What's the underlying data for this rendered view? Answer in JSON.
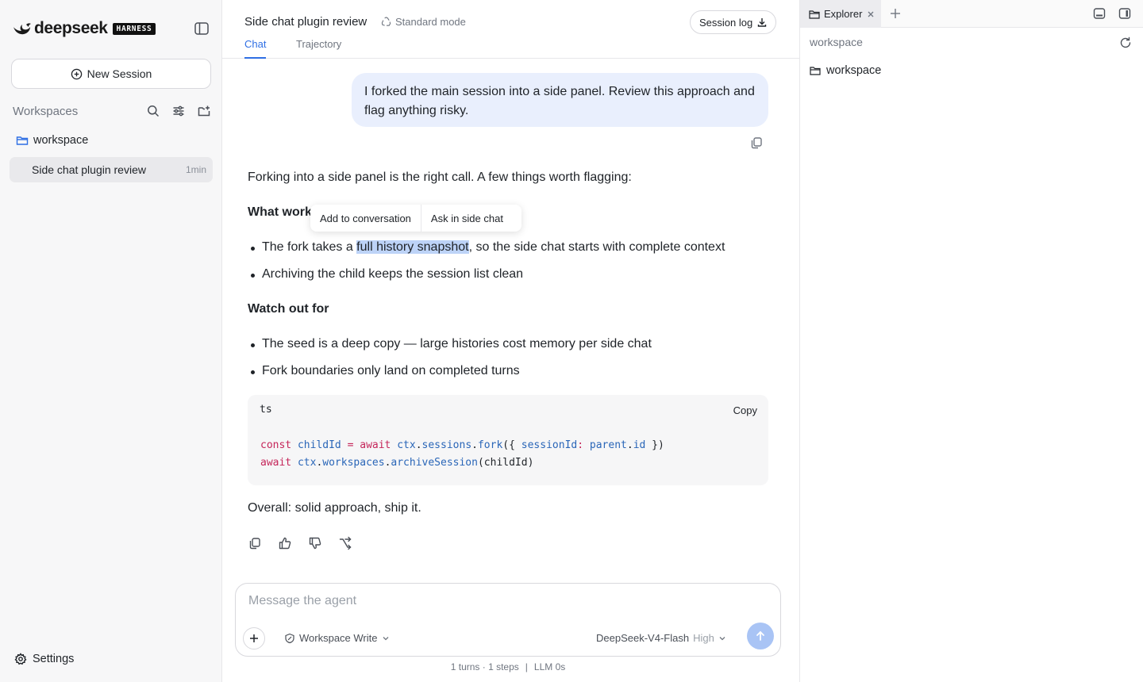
{
  "brand": {
    "name": "deepseek",
    "badge": "HARNESS"
  },
  "sidebar": {
    "new_session_label": "New Session",
    "workspaces_label": "Workspaces",
    "folder_name": "workspace",
    "sessions": [
      {
        "label": "Side chat plugin review",
        "time": "1min"
      }
    ],
    "settings_label": "Settings"
  },
  "header": {
    "session_title": "Side chat plugin review",
    "mode_label": "Standard mode",
    "session_log_label": "Session log",
    "tabs": [
      {
        "label": "Chat",
        "active": true
      },
      {
        "label": "Trajectory",
        "active": false
      }
    ]
  },
  "chat": {
    "user_message": "I forked the main session into a side panel. Review this approach and flag anything risky.",
    "assistant": {
      "intro": "Forking into a side panel is the right call. A few things worth flagging:",
      "heading_1": "What works",
      "bullets_1": [
        {
          "before": "The fork takes a ",
          "selected": "full history snapshot",
          "after": ", so the side chat starts with complete context"
        },
        {
          "before": "Archiving the child keeps the session list clean",
          "selected": "",
          "after": ""
        }
      ],
      "heading_2": "Watch out for",
      "bullets_2": [
        "The seed is a deep copy — large histories cost memory per side chat",
        "Fork boundaries only land on completed turns"
      ],
      "code": {
        "language": "ts",
        "copy_label": "Copy",
        "lines": [
          "const childId = await ctx.sessions.fork({ sessionId: parent.id })",
          "await ctx.workspaces.archiveSession(childId)"
        ]
      },
      "outro": "Overall: solid approach, ship it."
    },
    "selection_popover": {
      "add_label": "Add to conversation",
      "ask_label": "Ask in side chat"
    }
  },
  "composer": {
    "placeholder": "Message the agent",
    "value": "",
    "permission_label": "Workspace Write",
    "model_label": "DeepSeek-V4-Flash",
    "effort_label": "High"
  },
  "footer": {
    "turns_steps": "1 turns · 1 steps",
    "separator": "|",
    "llm_time": "LLM 0s"
  },
  "explorer": {
    "tab_label": "Explorer",
    "path_label": "workspace",
    "tree": [
      {
        "name": "workspace",
        "type": "folder"
      }
    ]
  },
  "colors": {
    "accent": "#2f6fe4",
    "user_bubble": "#e9effd",
    "selection": "#bdd3f7",
    "send_button": "#a9c4f5"
  }
}
